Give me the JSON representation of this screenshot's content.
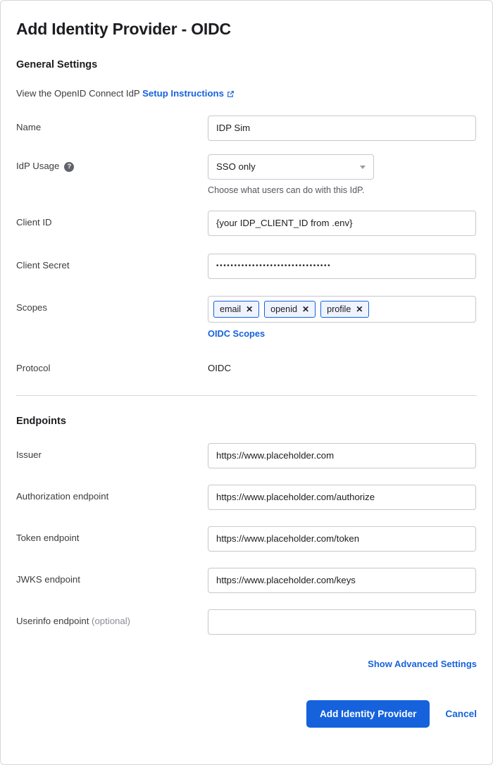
{
  "page": {
    "title": "Add Identity Provider - OIDC"
  },
  "general": {
    "section_title": "General Settings",
    "intro_text": "View the OpenID Connect IdP",
    "intro_link": "Setup Instructions",
    "external_link_icon": "external-link-icon",
    "fields": {
      "name": {
        "label": "Name",
        "value": "IDP Sim",
        "placeholder": ""
      },
      "idp_usage": {
        "label": "IdP Usage",
        "help_icon": "question-mark-icon",
        "help_glyph": "?",
        "value": "SSO only",
        "options": [
          "SSO only"
        ],
        "hint": "Choose what users can do with this IdP.",
        "caret_icon": "chevron-down-icon"
      },
      "client_id": {
        "label": "Client ID",
        "value": "{your IDP_CLIENT_ID from .env}",
        "placeholder": ""
      },
      "client_secret": {
        "label": "Client Secret",
        "value": "••••••••••••••••••••••••••••••••",
        "placeholder": ""
      },
      "scopes": {
        "label": "Scopes",
        "chips": [
          {
            "text": "email",
            "remove_glyph": "✕"
          },
          {
            "text": "openid",
            "remove_glyph": "✕"
          },
          {
            "text": "profile",
            "remove_glyph": "✕"
          }
        ],
        "sublink": "OIDC Scopes"
      },
      "protocol": {
        "label": "Protocol",
        "value": "OIDC"
      }
    }
  },
  "endpoints": {
    "section_title": "Endpoints",
    "fields": {
      "issuer": {
        "label": "Issuer",
        "value": "https://www.placeholder.com",
        "placeholder": ""
      },
      "authorization": {
        "label": "Authorization endpoint",
        "value": "https://www.placeholder.com/authorize",
        "placeholder": ""
      },
      "token": {
        "label": "Token endpoint",
        "value": "https://www.placeholder.com/token",
        "placeholder": ""
      },
      "jwks": {
        "label": "JWKS endpoint",
        "value": "https://www.placeholder.com/keys",
        "placeholder": ""
      },
      "userinfo": {
        "label": "Userinfo endpoint",
        "label_optional": "(optional)",
        "value": "",
        "placeholder": ""
      }
    }
  },
  "footer": {
    "advanced_link": "Show Advanced Settings",
    "submit_label": "Add Identity Provider",
    "cancel_label": "Cancel"
  },
  "colors": {
    "accent_blue": "#1662dc",
    "chip_background": "#eef3fd",
    "border_gray": "#c8c8cf",
    "divider_gray": "#d7d7dc",
    "text_primary": "#1d1d21",
    "text_secondary": "#57575e",
    "help_icon_gray": "#62626e"
  }
}
